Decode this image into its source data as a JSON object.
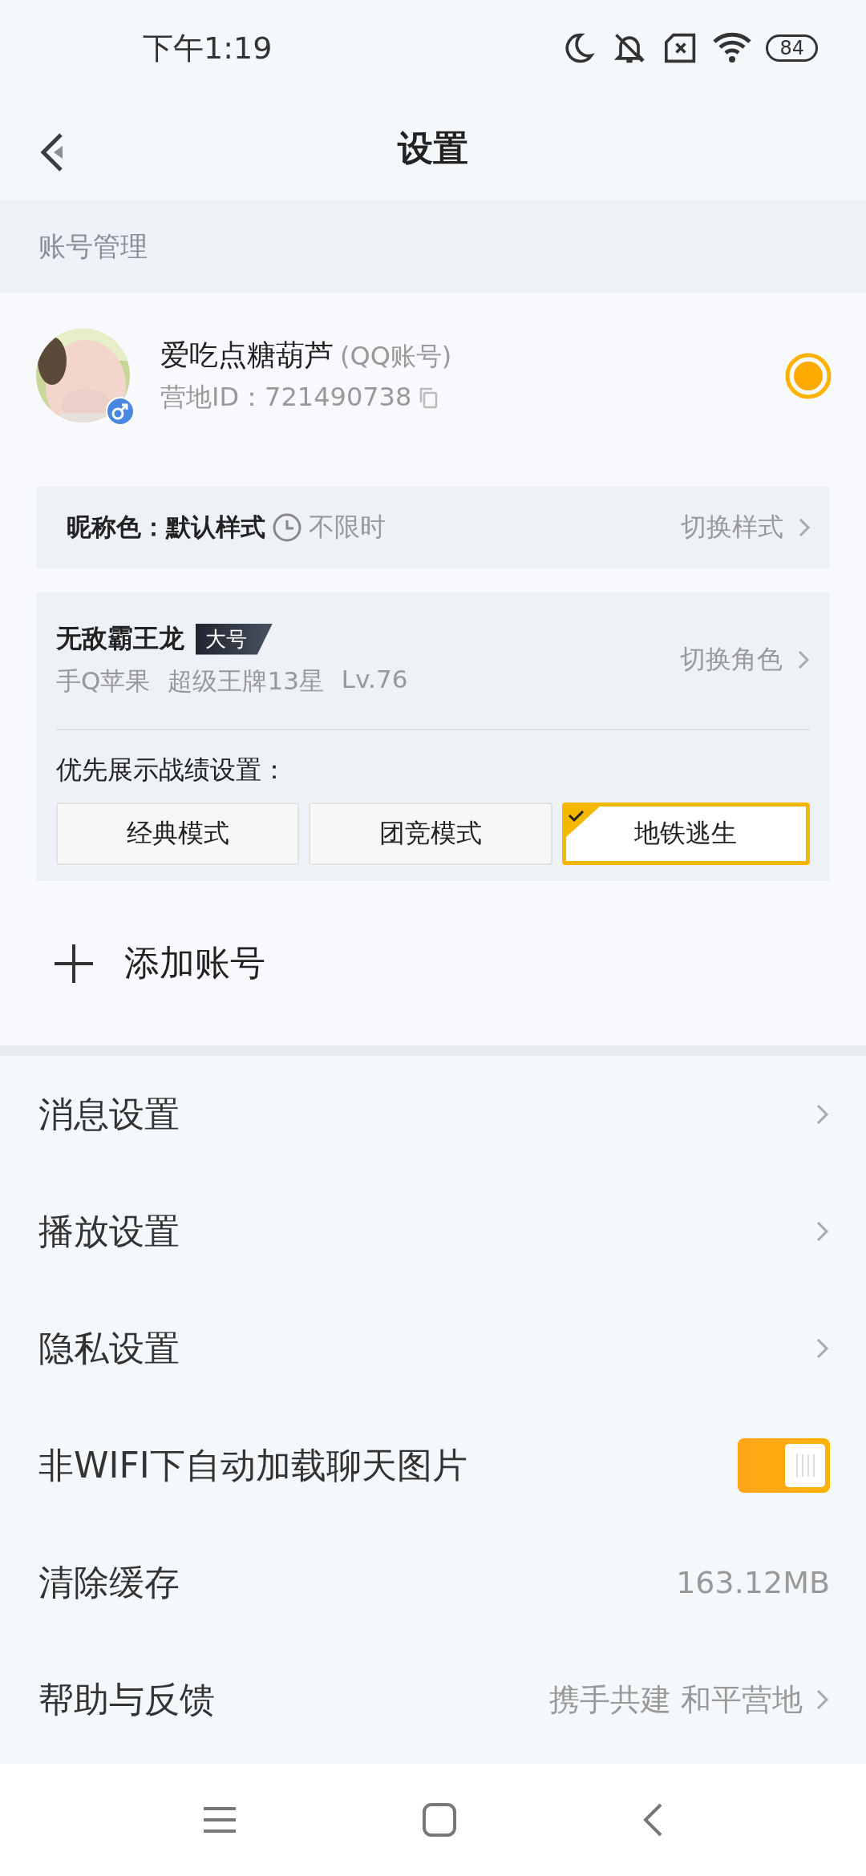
{
  "status_bar": {
    "time": "下午1:19",
    "battery": "84"
  },
  "header": {
    "title": "设置"
  },
  "section": {
    "title": "账号管理"
  },
  "account": {
    "name": "爱吃点糖葫芦",
    "type": "(QQ账号)",
    "id_label": "营地ID：",
    "id": "721490738",
    "selected": true,
    "nickname_color": {
      "label": "昵称色：",
      "value": "默认样式",
      "duration": "不限时",
      "action": "切换样式"
    },
    "role": {
      "name": "无敌霸王龙",
      "badge": "大号",
      "details": [
        "手Q苹果",
        "超级王牌13星",
        "Lv.76"
      ],
      "action": "切换角色",
      "priority_label": "优先展示战绩设置：",
      "modes": [
        {
          "label": "经典模式",
          "selected": false
        },
        {
          "label": "团竞模式",
          "selected": false
        },
        {
          "label": "地铁逃生",
          "selected": true
        }
      ]
    }
  },
  "add_account": {
    "label": "添加账号"
  },
  "settings": [
    {
      "kind": "link",
      "label": "消息设置"
    },
    {
      "kind": "link",
      "label": "播放设置"
    },
    {
      "kind": "link",
      "label": "隐私设置"
    },
    {
      "kind": "toggle",
      "label": "非WIFI下自动加载聊天图片",
      "on": true
    },
    {
      "kind": "value",
      "label": "清除缓存",
      "value": "163.12MB"
    },
    {
      "kind": "link",
      "label": "帮助与反馈",
      "value": "携手共建 和平营地"
    }
  ]
}
